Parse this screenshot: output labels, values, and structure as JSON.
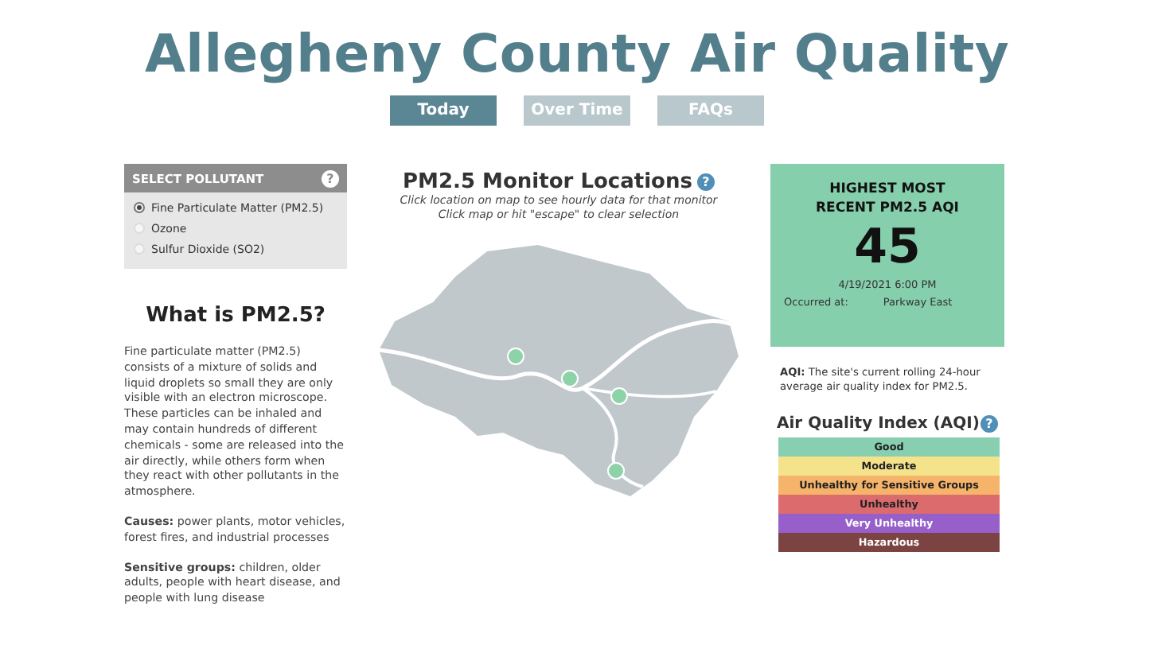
{
  "title": "Allegheny County Air Quality",
  "tabs": [
    {
      "label": "Today",
      "selected": true
    },
    {
      "label": "Over Time",
      "selected": false
    },
    {
      "label": "FAQs",
      "selected": false
    }
  ],
  "pollutant_panel": {
    "header": "SELECT POLLUTANT",
    "help": "?",
    "options": [
      {
        "label": "Fine Particulate Matter (PM2.5)",
        "selected": true
      },
      {
        "label": "Ozone",
        "selected": false
      },
      {
        "label": "Sulfur Dioxide (SO2)",
        "selected": false
      }
    ]
  },
  "info": {
    "heading": "What is PM2.5?",
    "paragraphs": [
      "Fine particulate matter (PM2.5) consists of a mixture of solids and liquid droplets so small they are only visible with an electron microscope. These particles can be inhaled and may contain hundreds of different chemicals - some are released into the air directly, while others form when they react with other pollutants in the atmosphere.",
      "**Causes:**  power plants, motor vehicles, forest fires, and industrial processes",
      "**Sensitive groups:**  children, older adults, people with heart disease, and people with lung disease"
    ]
  },
  "map": {
    "title": "PM2.5 Monitor Locations",
    "help": "?",
    "instructions": [
      "Click location on map to see hourly data for that monitor",
      "Click map or hit \"escape\" to clear selection"
    ]
  },
  "aqi_card": {
    "title": "HIGHEST MOST RECENT PM2.5 AQI",
    "value": "45",
    "datetime": "4/19/2021 6:00 PM",
    "occurred_label": "Occurred at:",
    "location": "Parkway East"
  },
  "aqi_note": "**AQI:**  The site's current rolling 24-hour average air quality index for PM2.5.",
  "legend": {
    "title": "Air Quality Index (AQI)",
    "help": "?",
    "items": [
      {
        "label": "Good",
        "color": "#88cfb2"
      },
      {
        "label": "Moderate",
        "color": "#f5e38c"
      },
      {
        "label": "Unhealthy for Sensitive Groups",
        "color": "#f5b469"
      },
      {
        "label": "Unhealthy",
        "color": "#dc6b6e"
      },
      {
        "label": "Very Unhealthy",
        "color": "#965fc9"
      },
      {
        "label": "Hazardous",
        "color": "#7b4341"
      }
    ]
  }
}
